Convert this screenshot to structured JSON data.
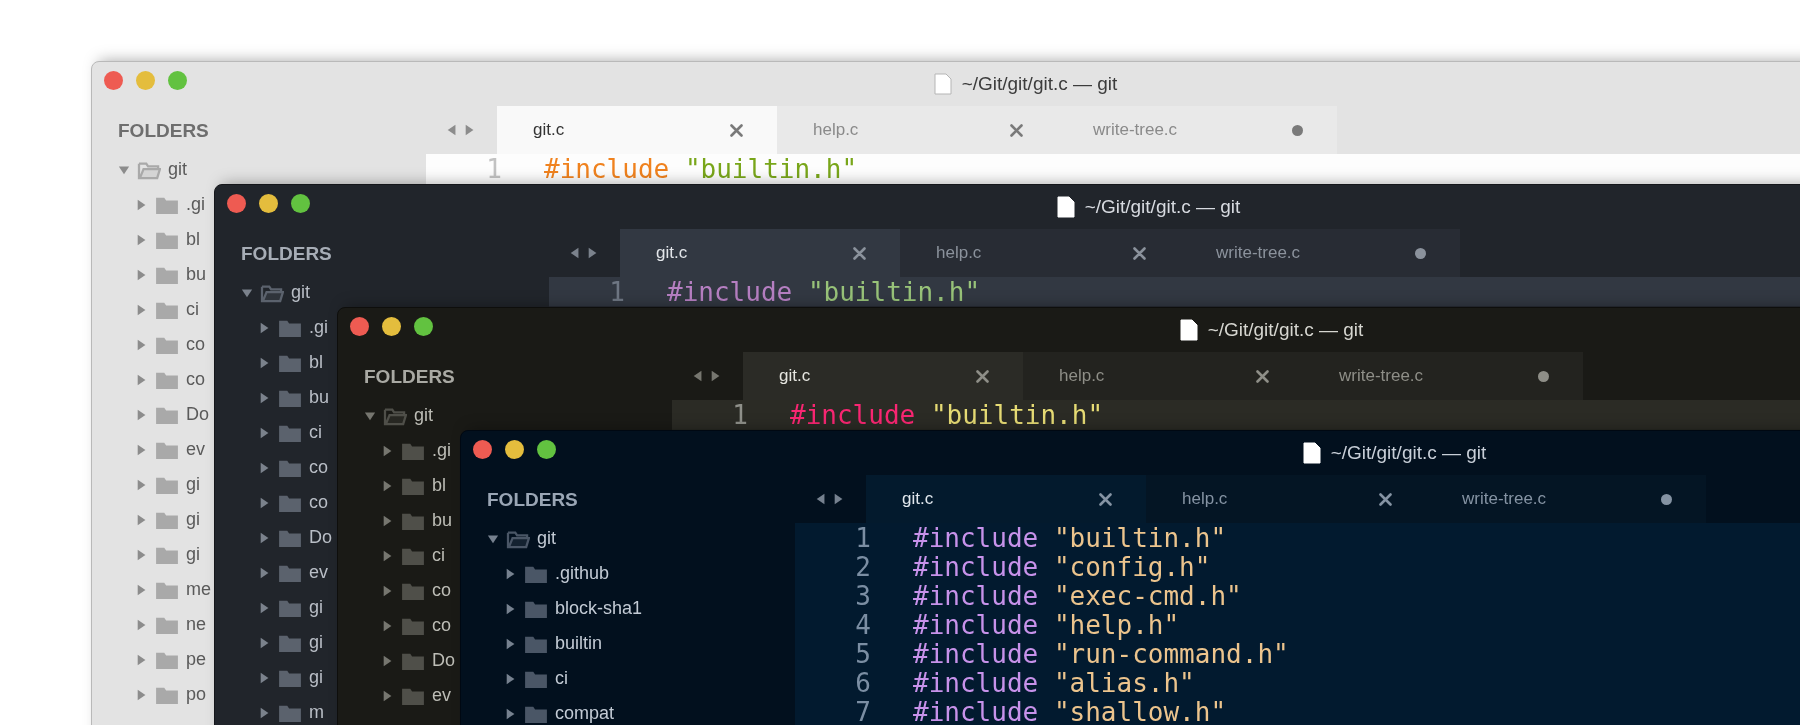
{
  "windows": [
    {
      "kind": "light",
      "title": "~/Git/git/git.c — git",
      "sidebar": {
        "heading": "FOLDERS",
        "root": {
          "label": "git",
          "expanded": true,
          "children": [
            {
              "label": ".gi",
              "expanded": false
            },
            {
              "label": "bl",
              "expanded": false
            },
            {
              "label": "bu",
              "expanded": false
            },
            {
              "label": "ci",
              "expanded": false
            },
            {
              "label": "co",
              "expanded": false
            },
            {
              "label": "co",
              "expanded": false
            },
            {
              "label": "Do",
              "expanded": false
            },
            {
              "label": "ev",
              "expanded": false
            },
            {
              "label": "gi",
              "expanded": false
            },
            {
              "label": "gi",
              "expanded": false
            },
            {
              "label": "gi",
              "expanded": false
            },
            {
              "label": "me",
              "expanded": false
            },
            {
              "label": "ne",
              "expanded": false
            },
            {
              "label": "pe",
              "expanded": false
            },
            {
              "label": "po",
              "expanded": false
            }
          ]
        }
      },
      "tabs": [
        {
          "label": "git.c",
          "selected": true,
          "modified": false
        },
        {
          "label": "help.c",
          "selected": false,
          "modified": false
        },
        {
          "label": "write-tree.c",
          "selected": false,
          "modified": true
        }
      ],
      "code": [
        {
          "number": "1",
          "directive": "#include",
          "file": "\"builtin.h\""
        }
      ]
    },
    {
      "kind": "slate",
      "title": "~/Git/git/git.c — git",
      "sidebar": {
        "heading": "FOLDERS",
        "root": {
          "label": "git",
          "expanded": true,
          "children": [
            {
              "label": ".gi",
              "expanded": false
            },
            {
              "label": "bl",
              "expanded": false
            },
            {
              "label": "bu",
              "expanded": false
            },
            {
              "label": "ci",
              "expanded": false
            },
            {
              "label": "co",
              "expanded": false
            },
            {
              "label": "co",
              "expanded": false
            },
            {
              "label": "Do",
              "expanded": false
            },
            {
              "label": "ev",
              "expanded": false
            },
            {
              "label": "gi",
              "expanded": false
            },
            {
              "label": "gi",
              "expanded": false
            },
            {
              "label": "gi",
              "expanded": false
            },
            {
              "label": "m",
              "expanded": false
            }
          ]
        }
      },
      "tabs": [
        {
          "label": "git.c",
          "selected": true,
          "modified": false
        },
        {
          "label": "help.c",
          "selected": false,
          "modified": false
        },
        {
          "label": "write-tree.c",
          "selected": false,
          "modified": true
        }
      ],
      "code": [
        {
          "number": "1",
          "directive": "#include",
          "file": "\"builtin.h\""
        }
      ]
    },
    {
      "kind": "monokai",
      "title": "~/Git/git/git.c — git",
      "sidebar": {
        "heading": "FOLDERS",
        "root": {
          "label": "git",
          "expanded": true,
          "children": [
            {
              "label": ".gi",
              "expanded": false
            },
            {
              "label": "bl",
              "expanded": false
            },
            {
              "label": "bu",
              "expanded": false
            },
            {
              "label": "ci",
              "expanded": false
            },
            {
              "label": "co",
              "expanded": false
            },
            {
              "label": "co",
              "expanded": false
            },
            {
              "label": "Do",
              "expanded": false
            },
            {
              "label": "ev",
              "expanded": false
            }
          ]
        }
      },
      "tabs": [
        {
          "label": "git.c",
          "selected": true,
          "modified": false
        },
        {
          "label": "help.c",
          "selected": false,
          "modified": false
        },
        {
          "label": "write-tree.c",
          "selected": false,
          "modified": true
        }
      ],
      "code": [
        {
          "number": "1",
          "directive": "#include",
          "file": "\"builtin.h\""
        }
      ]
    },
    {
      "kind": "navy",
      "title": "~/Git/git/git.c — git",
      "sidebar": {
        "heading": "FOLDERS",
        "root": {
          "label": "git",
          "expanded": true,
          "children": [
            {
              "label": ".github",
              "expanded": false
            },
            {
              "label": "block-sha1",
              "expanded": false
            },
            {
              "label": "builtin",
              "expanded": false
            },
            {
              "label": "ci",
              "expanded": false
            },
            {
              "label": "compat",
              "expanded": false
            }
          ]
        }
      },
      "tabs": [
        {
          "label": "git.c",
          "selected": true,
          "modified": false
        },
        {
          "label": "help.c",
          "selected": false,
          "modified": false
        },
        {
          "label": "write-tree.c",
          "selected": false,
          "modified": true
        }
      ],
      "code": [
        {
          "number": "1",
          "directive": "#include",
          "file": "\"builtin.h\""
        },
        {
          "number": "2",
          "directive": "#include",
          "file": "\"config.h\""
        },
        {
          "number": "3",
          "directive": "#include",
          "file": "\"exec-cmd.h\""
        },
        {
          "number": "4",
          "directive": "#include",
          "file": "\"help.h\""
        },
        {
          "number": "5",
          "directive": "#include",
          "file": "\"run-command.h\""
        },
        {
          "number": "6",
          "directive": "#include",
          "file": "\"alias.h\""
        },
        {
          "number": "7",
          "directive": "#include",
          "file": "\"shallow.h\""
        }
      ]
    }
  ]
}
